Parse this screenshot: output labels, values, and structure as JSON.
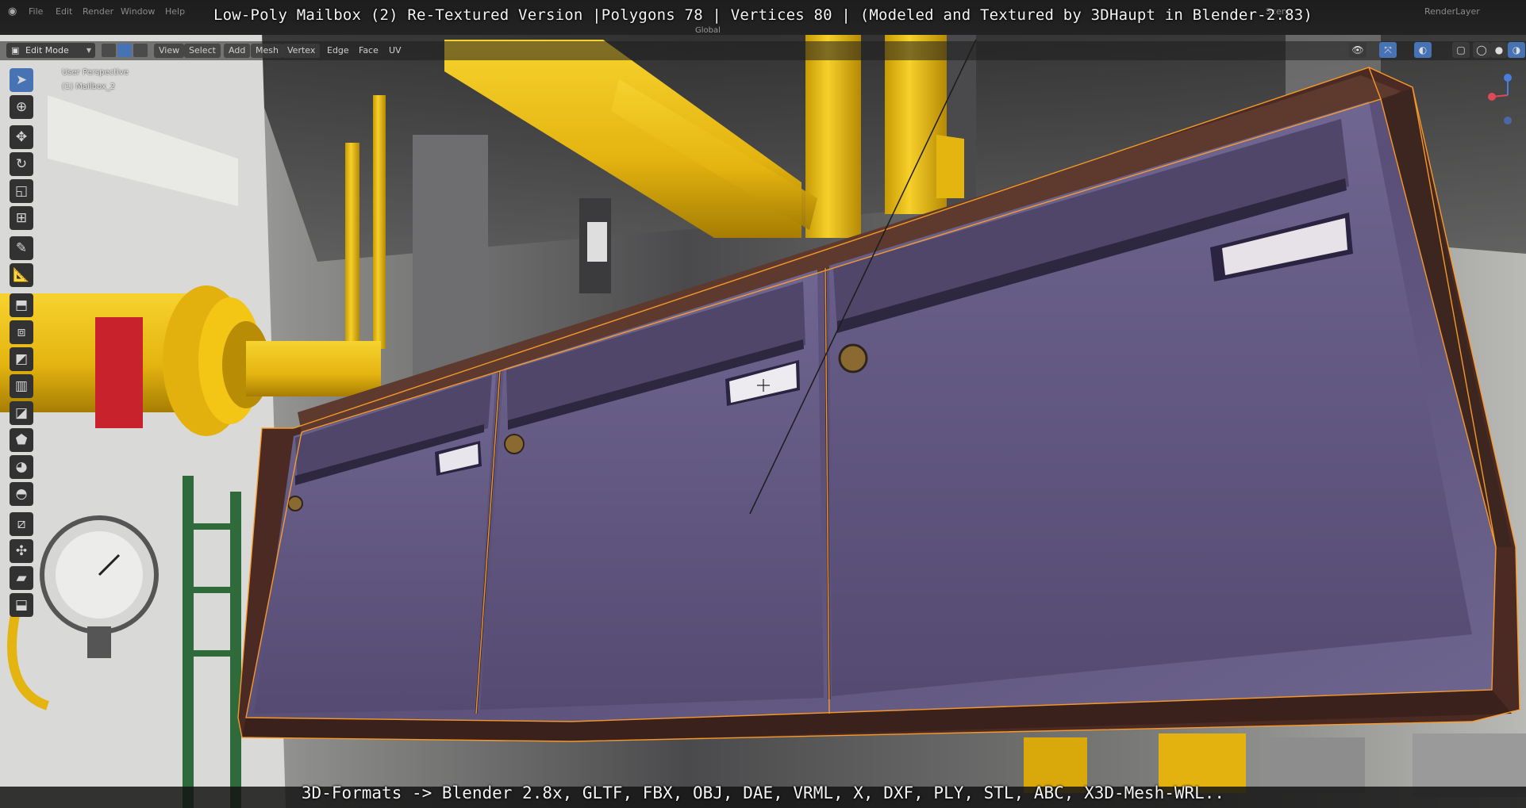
{
  "video_overlay": {
    "title": "Low-Poly Mailbox (2) Re-Textured Version |Polygons 78 | Vertices 80 | (Modeled and Textured by 3DHaupt in Blender-2.83)",
    "formats": "3D-Formats -> Blender 2.8x, GLTF, FBX, OBJ, DAE, VRML, X, DXF, PLY, STL, ABC, X3D-Mesh-WRL.."
  },
  "topbar": {
    "menus": [
      "File",
      "Edit",
      "Render",
      "Window",
      "Help"
    ],
    "scene_label": "Scene",
    "layer_label": "RenderLayer"
  },
  "header": {
    "mode": "Edit Mode",
    "menus": [
      "View",
      "Select",
      "Add",
      "Mesh",
      "Vertex",
      "Edge",
      "Face",
      "UV"
    ],
    "orientation": "Global"
  },
  "viewport": {
    "perspective": "User Perspective",
    "object": "(1) Mailbox_2"
  },
  "toolbar": {
    "tools": [
      "select-box-icon",
      "cursor-icon",
      "move-icon",
      "rotate-icon",
      "scale-icon",
      "transform-icon",
      "annotate-icon",
      "measure-icon",
      "extrude-icon",
      "inset-icon",
      "bevel-icon",
      "loop-cut-icon",
      "knife-icon",
      "poly-build-icon",
      "spin-icon",
      "smooth-icon",
      "edge-slide-icon",
      "shrink-fatten-icon",
      "shear-icon",
      "rip-icon"
    ]
  },
  "colors": {
    "accent": "#4772b3",
    "mailbox": "#5a4f78",
    "frame": "#4a2a22",
    "pipe_yellow": "#f2c313",
    "pipe_red": "#c8222d",
    "wireframe": "#ff9e2a"
  }
}
